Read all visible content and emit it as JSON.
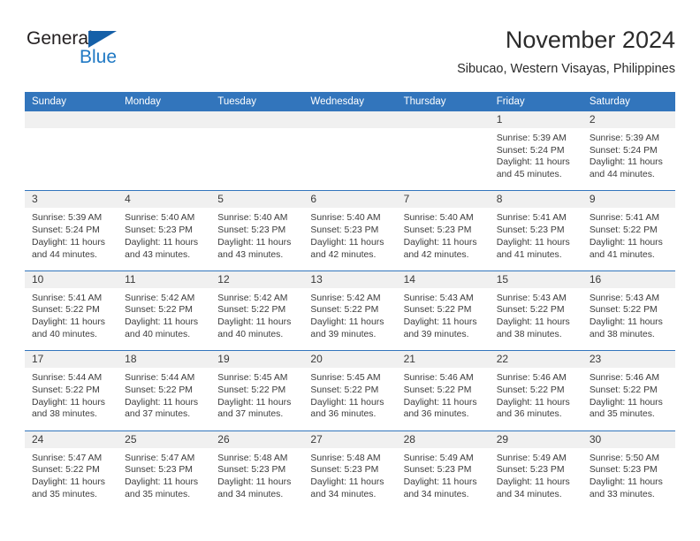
{
  "brand": {
    "name_part1": "General",
    "name_part2": "Blue",
    "triangle_color": "#1560a8",
    "blue_text_color": "#2079c4"
  },
  "header": {
    "title": "November 2024",
    "subtitle": "Sibucao, Western Visayas, Philippines"
  },
  "colors": {
    "header_blue": "#3275bc",
    "daynum_strip": "#f0f0f0",
    "cell_bg": "#ffffff",
    "text": "#3c3c3c"
  },
  "weekdays": [
    "Sunday",
    "Monday",
    "Tuesday",
    "Wednesday",
    "Thursday",
    "Friday",
    "Saturday"
  ],
  "weeks": [
    [
      {
        "day": "",
        "empty": true
      },
      {
        "day": "",
        "empty": true
      },
      {
        "day": "",
        "empty": true
      },
      {
        "day": "",
        "empty": true
      },
      {
        "day": "",
        "empty": true
      },
      {
        "day": "1",
        "sunrise": "Sunrise: 5:39 AM",
        "sunset": "Sunset: 5:24 PM",
        "daylight1": "Daylight: 11 hours",
        "daylight2": "and 45 minutes."
      },
      {
        "day": "2",
        "sunrise": "Sunrise: 5:39 AM",
        "sunset": "Sunset: 5:24 PM",
        "daylight1": "Daylight: 11 hours",
        "daylight2": "and 44 minutes."
      }
    ],
    [
      {
        "day": "3",
        "sunrise": "Sunrise: 5:39 AM",
        "sunset": "Sunset: 5:24 PM",
        "daylight1": "Daylight: 11 hours",
        "daylight2": "and 44 minutes."
      },
      {
        "day": "4",
        "sunrise": "Sunrise: 5:40 AM",
        "sunset": "Sunset: 5:23 PM",
        "daylight1": "Daylight: 11 hours",
        "daylight2": "and 43 minutes."
      },
      {
        "day": "5",
        "sunrise": "Sunrise: 5:40 AM",
        "sunset": "Sunset: 5:23 PM",
        "daylight1": "Daylight: 11 hours",
        "daylight2": "and 43 minutes."
      },
      {
        "day": "6",
        "sunrise": "Sunrise: 5:40 AM",
        "sunset": "Sunset: 5:23 PM",
        "daylight1": "Daylight: 11 hours",
        "daylight2": "and 42 minutes."
      },
      {
        "day": "7",
        "sunrise": "Sunrise: 5:40 AM",
        "sunset": "Sunset: 5:23 PM",
        "daylight1": "Daylight: 11 hours",
        "daylight2": "and 42 minutes."
      },
      {
        "day": "8",
        "sunrise": "Sunrise: 5:41 AM",
        "sunset": "Sunset: 5:23 PM",
        "daylight1": "Daylight: 11 hours",
        "daylight2": "and 41 minutes."
      },
      {
        "day": "9",
        "sunrise": "Sunrise: 5:41 AM",
        "sunset": "Sunset: 5:22 PM",
        "daylight1": "Daylight: 11 hours",
        "daylight2": "and 41 minutes."
      }
    ],
    [
      {
        "day": "10",
        "sunrise": "Sunrise: 5:41 AM",
        "sunset": "Sunset: 5:22 PM",
        "daylight1": "Daylight: 11 hours",
        "daylight2": "and 40 minutes."
      },
      {
        "day": "11",
        "sunrise": "Sunrise: 5:42 AM",
        "sunset": "Sunset: 5:22 PM",
        "daylight1": "Daylight: 11 hours",
        "daylight2": "and 40 minutes."
      },
      {
        "day": "12",
        "sunrise": "Sunrise: 5:42 AM",
        "sunset": "Sunset: 5:22 PM",
        "daylight1": "Daylight: 11 hours",
        "daylight2": "and 40 minutes."
      },
      {
        "day": "13",
        "sunrise": "Sunrise: 5:42 AM",
        "sunset": "Sunset: 5:22 PM",
        "daylight1": "Daylight: 11 hours",
        "daylight2": "and 39 minutes."
      },
      {
        "day": "14",
        "sunrise": "Sunrise: 5:43 AM",
        "sunset": "Sunset: 5:22 PM",
        "daylight1": "Daylight: 11 hours",
        "daylight2": "and 39 minutes."
      },
      {
        "day": "15",
        "sunrise": "Sunrise: 5:43 AM",
        "sunset": "Sunset: 5:22 PM",
        "daylight1": "Daylight: 11 hours",
        "daylight2": "and 38 minutes."
      },
      {
        "day": "16",
        "sunrise": "Sunrise: 5:43 AM",
        "sunset": "Sunset: 5:22 PM",
        "daylight1": "Daylight: 11 hours",
        "daylight2": "and 38 minutes."
      }
    ],
    [
      {
        "day": "17",
        "sunrise": "Sunrise: 5:44 AM",
        "sunset": "Sunset: 5:22 PM",
        "daylight1": "Daylight: 11 hours",
        "daylight2": "and 38 minutes."
      },
      {
        "day": "18",
        "sunrise": "Sunrise: 5:44 AM",
        "sunset": "Sunset: 5:22 PM",
        "daylight1": "Daylight: 11 hours",
        "daylight2": "and 37 minutes."
      },
      {
        "day": "19",
        "sunrise": "Sunrise: 5:45 AM",
        "sunset": "Sunset: 5:22 PM",
        "daylight1": "Daylight: 11 hours",
        "daylight2": "and 37 minutes."
      },
      {
        "day": "20",
        "sunrise": "Sunrise: 5:45 AM",
        "sunset": "Sunset: 5:22 PM",
        "daylight1": "Daylight: 11 hours",
        "daylight2": "and 36 minutes."
      },
      {
        "day": "21",
        "sunrise": "Sunrise: 5:46 AM",
        "sunset": "Sunset: 5:22 PM",
        "daylight1": "Daylight: 11 hours",
        "daylight2": "and 36 minutes."
      },
      {
        "day": "22",
        "sunrise": "Sunrise: 5:46 AM",
        "sunset": "Sunset: 5:22 PM",
        "daylight1": "Daylight: 11 hours",
        "daylight2": "and 36 minutes."
      },
      {
        "day": "23",
        "sunrise": "Sunrise: 5:46 AM",
        "sunset": "Sunset: 5:22 PM",
        "daylight1": "Daylight: 11 hours",
        "daylight2": "and 35 minutes."
      }
    ],
    [
      {
        "day": "24",
        "sunrise": "Sunrise: 5:47 AM",
        "sunset": "Sunset: 5:22 PM",
        "daylight1": "Daylight: 11 hours",
        "daylight2": "and 35 minutes."
      },
      {
        "day": "25",
        "sunrise": "Sunrise: 5:47 AM",
        "sunset": "Sunset: 5:23 PM",
        "daylight1": "Daylight: 11 hours",
        "daylight2": "and 35 minutes."
      },
      {
        "day": "26",
        "sunrise": "Sunrise: 5:48 AM",
        "sunset": "Sunset: 5:23 PM",
        "daylight1": "Daylight: 11 hours",
        "daylight2": "and 34 minutes."
      },
      {
        "day": "27",
        "sunrise": "Sunrise: 5:48 AM",
        "sunset": "Sunset: 5:23 PM",
        "daylight1": "Daylight: 11 hours",
        "daylight2": "and 34 minutes."
      },
      {
        "day": "28",
        "sunrise": "Sunrise: 5:49 AM",
        "sunset": "Sunset: 5:23 PM",
        "daylight1": "Daylight: 11 hours",
        "daylight2": "and 34 minutes."
      },
      {
        "day": "29",
        "sunrise": "Sunrise: 5:49 AM",
        "sunset": "Sunset: 5:23 PM",
        "daylight1": "Daylight: 11 hours",
        "daylight2": "and 34 minutes."
      },
      {
        "day": "30",
        "sunrise": "Sunrise: 5:50 AM",
        "sunset": "Sunset: 5:23 PM",
        "daylight1": "Daylight: 11 hours",
        "daylight2": "and 33 minutes."
      }
    ]
  ]
}
